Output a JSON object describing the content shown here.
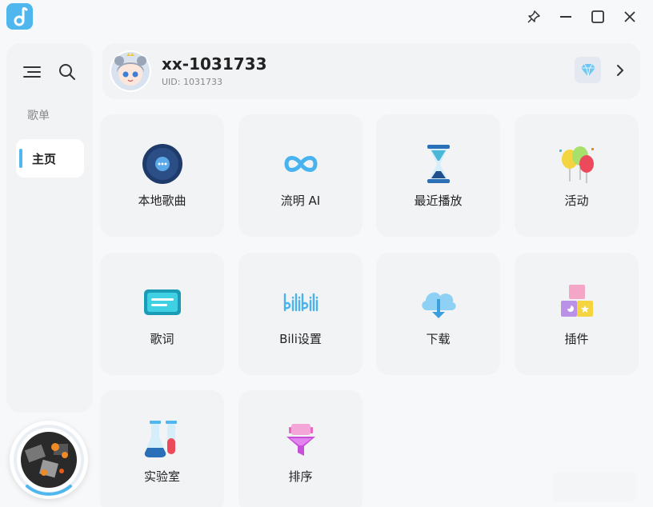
{
  "window": {
    "controls": [
      {
        "name": "pin-button",
        "icon": "pin-icon"
      },
      {
        "name": "minimize-button",
        "icon": "minimize-icon"
      },
      {
        "name": "maximize-button",
        "icon": "maximize-icon"
      },
      {
        "name": "close-button",
        "icon": "close-icon"
      }
    ]
  },
  "sidebar": {
    "section_label": "歌单",
    "items": [
      {
        "label": "主页",
        "active": true
      }
    ]
  },
  "profile": {
    "username": "xx-1031733",
    "uid": "UID: 1031733"
  },
  "tiles": [
    {
      "label": "本地歌曲",
      "icon": "vinyl-disc-icon"
    },
    {
      "label": "流明 AI",
      "icon": "infinity-icon"
    },
    {
      "label": "最近播放",
      "icon": "hourglass-icon"
    },
    {
      "label": "活动",
      "icon": "balloons-icon"
    },
    {
      "label": "歌词",
      "icon": "lyrics-icon"
    },
    {
      "label": "Bili设置",
      "icon": "bilibili-icon"
    },
    {
      "label": "下载",
      "icon": "cloud-download-icon"
    },
    {
      "label": "插件",
      "icon": "blocks-icon"
    },
    {
      "label": "实验室",
      "icon": "test-tubes-icon"
    },
    {
      "label": "排序",
      "icon": "funnel-icon"
    }
  ],
  "colors": {
    "accent": "#4fb6ee",
    "tile_bg": "#f2f3f5",
    "page_bg": "#f7f8fa"
  }
}
